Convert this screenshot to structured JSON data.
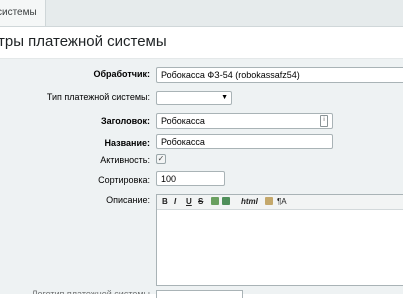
{
  "tab": {
    "label": "системы"
  },
  "title": "тры платежной системы",
  "form": {
    "handler": {
      "label": "Обработчик:",
      "value": "Робокасса ФЗ-54 (robokassafz54)"
    },
    "ps_type": {
      "label": "Тип платежной системы:",
      "value": ""
    },
    "heading": {
      "label": "Заголовок:",
      "value": "Робокасса"
    },
    "name": {
      "label": "Название:",
      "value": "Робокасса"
    },
    "active": {
      "label": "Активность:",
      "checked": true,
      "mark": "✓"
    },
    "sort": {
      "label": "Сортировка:",
      "value": "100"
    },
    "description": {
      "label": "Описание:"
    },
    "bottom_label": "Логотип платежной системы"
  },
  "toolbar": {
    "bold": "B",
    "italic": "I",
    "underline": "U",
    "strike": "S",
    "html": "html",
    "format": "¶A"
  },
  "colors": {
    "panel_bg": "#eef2f3",
    "border": "#a9b3b6"
  }
}
